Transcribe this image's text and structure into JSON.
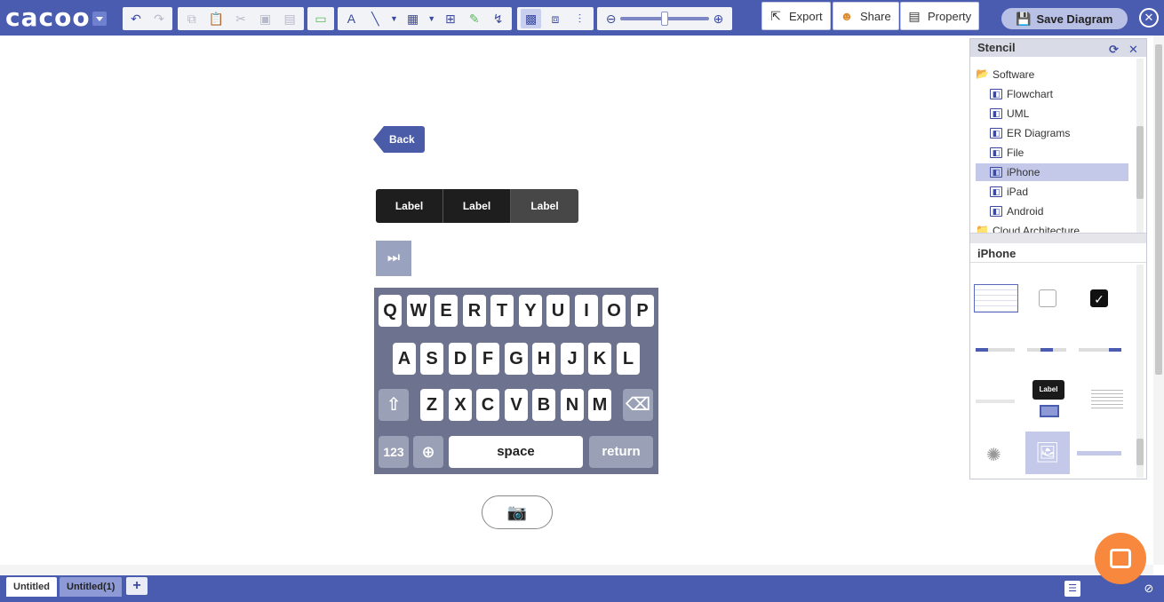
{
  "app": {
    "logo": "cacoo",
    "accent": "#4a5cb0"
  },
  "toolbar": {
    "export_label": "Export",
    "share_label": "Share",
    "property_label": "Property",
    "save_label": "Save Diagram"
  },
  "canvas": {
    "back_label": "Back",
    "segments": [
      "Label",
      "Label",
      "Label"
    ],
    "keyboard": {
      "row1": [
        "Q",
        "W",
        "E",
        "R",
        "T",
        "Y",
        "U",
        "I",
        "O",
        "P"
      ],
      "row2": [
        "A",
        "S",
        "D",
        "F",
        "G",
        "H",
        "J",
        "K",
        "L"
      ],
      "row3": [
        "Z",
        "X",
        "C",
        "V",
        "B",
        "N",
        "M"
      ],
      "numbers_label": "123",
      "space_label": "space",
      "return_label": "return"
    }
  },
  "stencil": {
    "title": "Stencil",
    "tree": [
      "Software",
      "Flowchart",
      "UML",
      "ER Diagrams",
      "File",
      "iPhone",
      "iPad",
      "Android",
      "Cloud Architecture"
    ],
    "selected": "iPhone",
    "section_title": "iPhone",
    "tooltip_label": "Label"
  },
  "tabs": [
    {
      "label": "Untitled",
      "active": true
    },
    {
      "label": "Untitled(1)",
      "active": false
    }
  ]
}
